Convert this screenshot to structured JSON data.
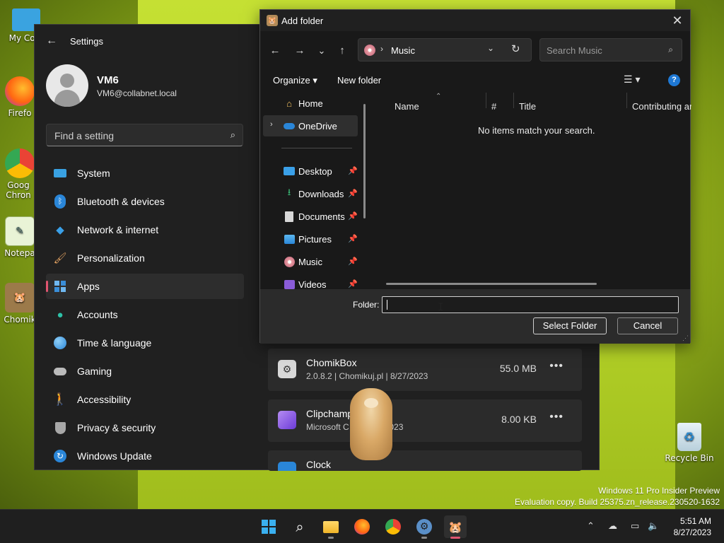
{
  "desktop": {
    "icons": [
      {
        "label": "My Com",
        "icon": "monitor-icon"
      },
      {
        "label": "Firefo",
        "icon": "firefox-icon"
      },
      {
        "label": "Goog Chron",
        "icon": "chrome-icon"
      },
      {
        "label": "Notepa",
        "icon": "notepad-icon"
      },
      {
        "label": "Chomik",
        "icon": "chomikbox-icon"
      },
      {
        "label": "Recycle Bin",
        "icon": "recycle-bin-icon"
      }
    ],
    "watermark": {
      "line1": "Windows 11 Pro Insider Preview",
      "line2": "Evaluation copy. Build 25375.zn_release.230520-1632"
    }
  },
  "settings": {
    "title": "Settings",
    "profile": {
      "name": "VM6",
      "email": "VM6@collabnet.local"
    },
    "search_placeholder": "Find a setting",
    "nav": [
      {
        "label": "System",
        "icon": "system-icon"
      },
      {
        "label": "Bluetooth & devices",
        "icon": "bluetooth-icon"
      },
      {
        "label": "Network & internet",
        "icon": "wifi-icon"
      },
      {
        "label": "Personalization",
        "icon": "brush-icon"
      },
      {
        "label": "Apps",
        "icon": "apps-icon",
        "active": true
      },
      {
        "label": "Accounts",
        "icon": "accounts-icon"
      },
      {
        "label": "Time & language",
        "icon": "globe-icon"
      },
      {
        "label": "Gaming",
        "icon": "gamepad-icon"
      },
      {
        "label": "Accessibility",
        "icon": "accessibility-icon"
      },
      {
        "label": "Privacy & security",
        "icon": "shield-icon"
      },
      {
        "label": "Windows Update",
        "icon": "update-icon"
      }
    ],
    "apps": [
      {
        "name": "ChomikBox",
        "meta": "2.0.8.2  |  Chomikuj.pl  |  8/27/2023",
        "size": "55.0 MB",
        "more": "•••"
      },
      {
        "name": "Clipchamp",
        "meta": "Microsoft C",
        "meta2": "7/2023",
        "size": "8.00 KB",
        "more": "•••"
      },
      {
        "name": "Clock",
        "meta": "",
        "size": "",
        "more": ""
      }
    ]
  },
  "dialog": {
    "title": "Add folder",
    "close": "✕",
    "nav_buttons": {
      "back": "←",
      "forward": "→",
      "recent": "⌄",
      "up": "↑"
    },
    "address": {
      "separator": "›",
      "location": "Music",
      "dropdown": "⌄",
      "refresh": "↻"
    },
    "search_placeholder": "Search Music",
    "commands": {
      "organize": "Organize ▾",
      "new_folder": "New folder",
      "help": "?"
    },
    "nav_pane": [
      {
        "label": "Home",
        "icon": "home-icon",
        "pinned": false
      },
      {
        "label": "OneDrive",
        "icon": "onedrive-icon",
        "pinned": false,
        "expandable": true,
        "selected": true
      },
      {
        "label": "Desktop",
        "icon": "desktop-icon",
        "pinned": true
      },
      {
        "label": "Downloads",
        "icon": "download-icon",
        "pinned": true
      },
      {
        "label": "Documents",
        "icon": "documents-icon",
        "pinned": true
      },
      {
        "label": "Pictures",
        "icon": "pictures-icon",
        "pinned": true
      },
      {
        "label": "Music",
        "icon": "music-icon",
        "pinned": true
      },
      {
        "label": "Videos",
        "icon": "videos-icon",
        "pinned": true
      }
    ],
    "columns": [
      "Name",
      "#",
      "Title",
      "Contributing art"
    ],
    "empty_message": "No items match your search.",
    "footer": {
      "folder_label": "Folder:",
      "folder_value": "",
      "select_button": "Select Folder",
      "cancel_button": "Cancel"
    }
  },
  "taskbar": {
    "items": [
      {
        "icon": "windows-start-icon"
      },
      {
        "icon": "search-icon"
      },
      {
        "icon": "file-explorer-icon",
        "running": true
      },
      {
        "icon": "firefox-icon"
      },
      {
        "icon": "chrome-icon"
      },
      {
        "icon": "settings-gear-icon",
        "running": true
      },
      {
        "icon": "chomikbox-icon",
        "running": true,
        "active": true
      }
    ],
    "clock": {
      "time": "5:51 AM",
      "date": "8/27/2023"
    }
  },
  "colors": {
    "accent": "#e05570",
    "wallpaper": "#b3d128",
    "window_bg": "#202020"
  }
}
